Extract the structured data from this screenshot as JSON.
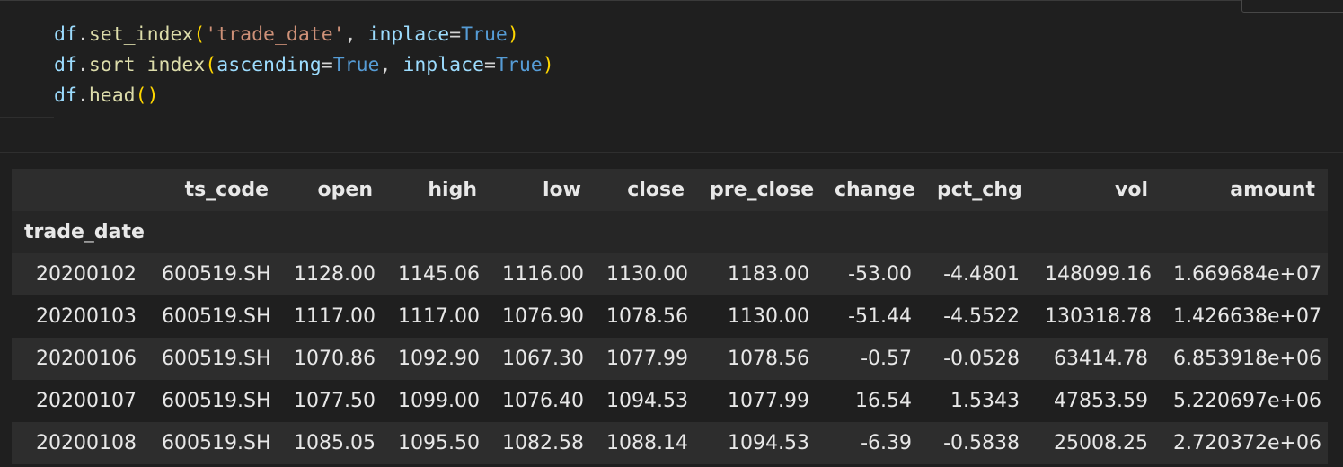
{
  "code_cell": {
    "lines": [
      [
        {
          "t": "df",
          "c": "var"
        },
        {
          "t": ".",
          "c": "op"
        },
        {
          "t": "set_index",
          "c": "fn"
        },
        {
          "t": "(",
          "c": "br1"
        },
        {
          "t": "'trade_date'",
          "c": "str"
        },
        {
          "t": ", ",
          "c": "op"
        },
        {
          "t": "inplace",
          "c": "var"
        },
        {
          "t": "=",
          "c": "op"
        },
        {
          "t": "True",
          "c": "kw"
        },
        {
          "t": ")",
          "c": "br1"
        }
      ],
      [
        {
          "t": "df",
          "c": "var"
        },
        {
          "t": ".",
          "c": "op"
        },
        {
          "t": "sort_index",
          "c": "fn"
        },
        {
          "t": "(",
          "c": "br1"
        },
        {
          "t": "ascending",
          "c": "var"
        },
        {
          "t": "=",
          "c": "op"
        },
        {
          "t": "True",
          "c": "kw"
        },
        {
          "t": ", ",
          "c": "op"
        },
        {
          "t": "inplace",
          "c": "var"
        },
        {
          "t": "=",
          "c": "op"
        },
        {
          "t": "True",
          "c": "kw"
        },
        {
          "t": ")",
          "c": "br1"
        }
      ],
      [
        {
          "t": "df",
          "c": "var"
        },
        {
          "t": ".",
          "c": "op"
        },
        {
          "t": "head",
          "c": "fn"
        },
        {
          "t": "()",
          "c": "br1"
        }
      ]
    ]
  },
  "output_table": {
    "index_name": "trade_date",
    "columns": [
      "ts_code",
      "open",
      "high",
      "low",
      "close",
      "pre_close",
      "change",
      "pct_chg",
      "vol",
      "amount"
    ],
    "rows": [
      {
        "index": "20200102",
        "values": [
          "600519.SH",
          "1128.00",
          "1145.06",
          "1116.00",
          "1130.00",
          "1183.00",
          "-53.00",
          "-4.4801",
          "148099.16",
          "1.669684e+07"
        ]
      },
      {
        "index": "20200103",
        "values": [
          "600519.SH",
          "1117.00",
          "1117.00",
          "1076.90",
          "1078.56",
          "1130.00",
          "-51.44",
          "-4.5522",
          "130318.78",
          "1.426638e+07"
        ]
      },
      {
        "index": "20200106",
        "values": [
          "600519.SH",
          "1070.86",
          "1092.90",
          "1067.30",
          "1077.99",
          "1078.56",
          "-0.57",
          "-0.0528",
          "63414.78",
          "6.853918e+06"
        ]
      },
      {
        "index": "20200107",
        "values": [
          "600519.SH",
          "1077.50",
          "1099.00",
          "1076.40",
          "1094.53",
          "1077.99",
          "16.54",
          "1.5343",
          "47853.59",
          "5.220697e+06"
        ]
      },
      {
        "index": "20200108",
        "values": [
          "600519.SH",
          "1085.05",
          "1095.50",
          "1082.58",
          "1088.14",
          "1094.53",
          "-6.39",
          "-0.5838",
          "25008.25",
          "2.720372e+06"
        ]
      }
    ]
  },
  "colors": {
    "background": "#1f1f1f",
    "row_alt": "#2d2d2d",
    "text": "#e8e8e8"
  }
}
